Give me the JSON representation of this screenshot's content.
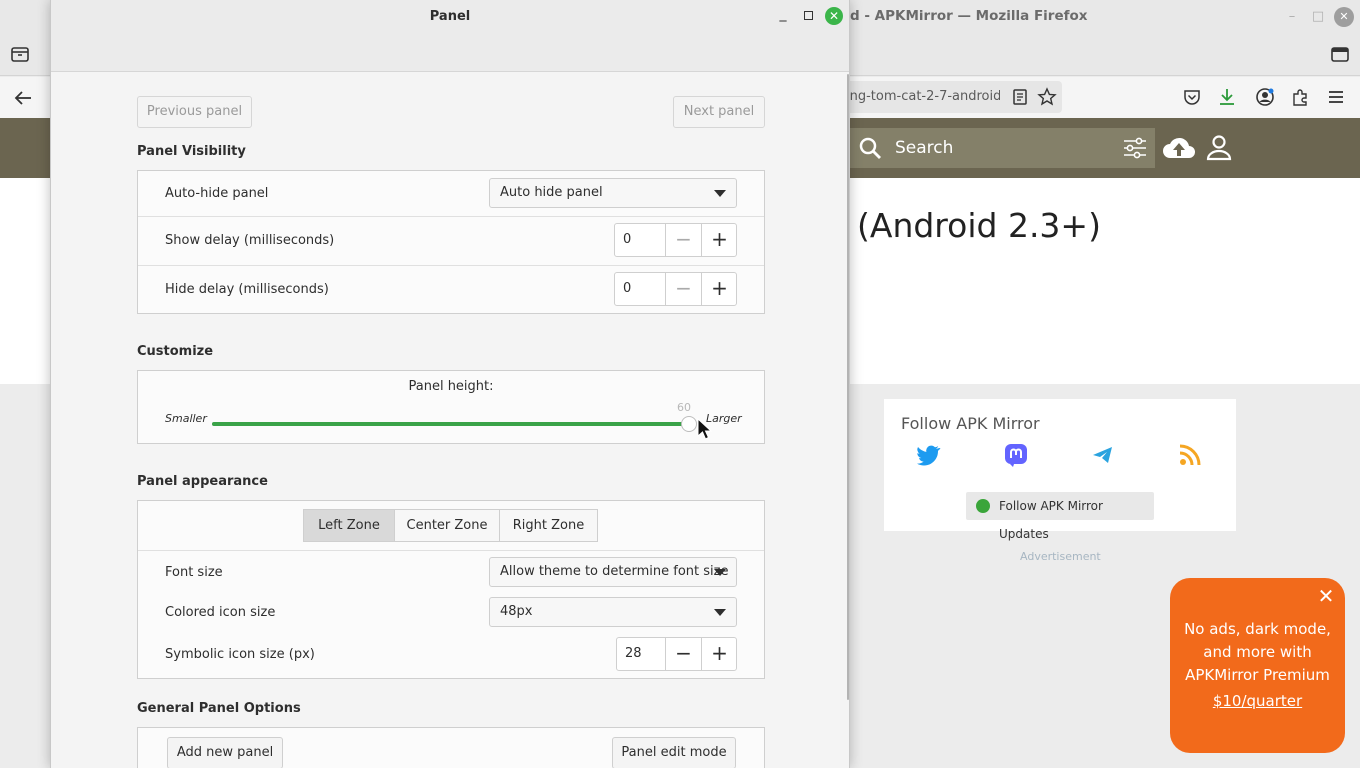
{
  "firefox": {
    "window_title": "d - APKMirror — Mozilla Firefox",
    "url": "ing-tom-cat-2-7-android",
    "page_headline": "(Android 2.3+)",
    "search_placeholder": "Search",
    "follow_title": "Follow APK Mirror",
    "follow_button": "Follow APK Mirror Updates",
    "ad_label": "Advertisement",
    "promo_text": "No ads, dark mode, and more with APKMirror Premium",
    "promo_price": "$10/quarter",
    "colors": {
      "header": "#6b6550",
      "promo": "#f26a1b",
      "mastodon": "#6364ff",
      "twitter": "#1d9bf0",
      "rss": "#f5a623"
    }
  },
  "dialog": {
    "title": "Panel",
    "prev_button": "Previous panel",
    "next_button": "Next panel",
    "visibility": {
      "title": "Panel Visibility",
      "autohide_label": "Auto-hide panel",
      "autohide_value": "Auto hide panel",
      "show_delay_label": "Show delay (milliseconds)",
      "show_delay_value": "0",
      "hide_delay_label": "Hide delay (milliseconds)",
      "hide_delay_value": "0"
    },
    "customize": {
      "title": "Customize",
      "height_label": "Panel height:",
      "smaller": "Smaller",
      "larger": "Larger",
      "height_value": "60",
      "height_fraction": 0.994
    },
    "appearance": {
      "title": "Panel appearance",
      "zones": [
        "Left Zone",
        "Center Zone",
        "Right Zone"
      ],
      "active_zone": "Left Zone",
      "font_size_label": "Font size",
      "font_size_value": "Allow theme to determine font size",
      "colored_icon_label": "Colored icon size",
      "colored_icon_value": "48px",
      "symbolic_icon_label": "Symbolic icon size (px)",
      "symbolic_icon_value": "28"
    },
    "general": {
      "title": "General Panel Options",
      "add_panel": "Add new panel",
      "edit_mode": "Panel edit mode"
    },
    "accent": "#3aa348"
  }
}
